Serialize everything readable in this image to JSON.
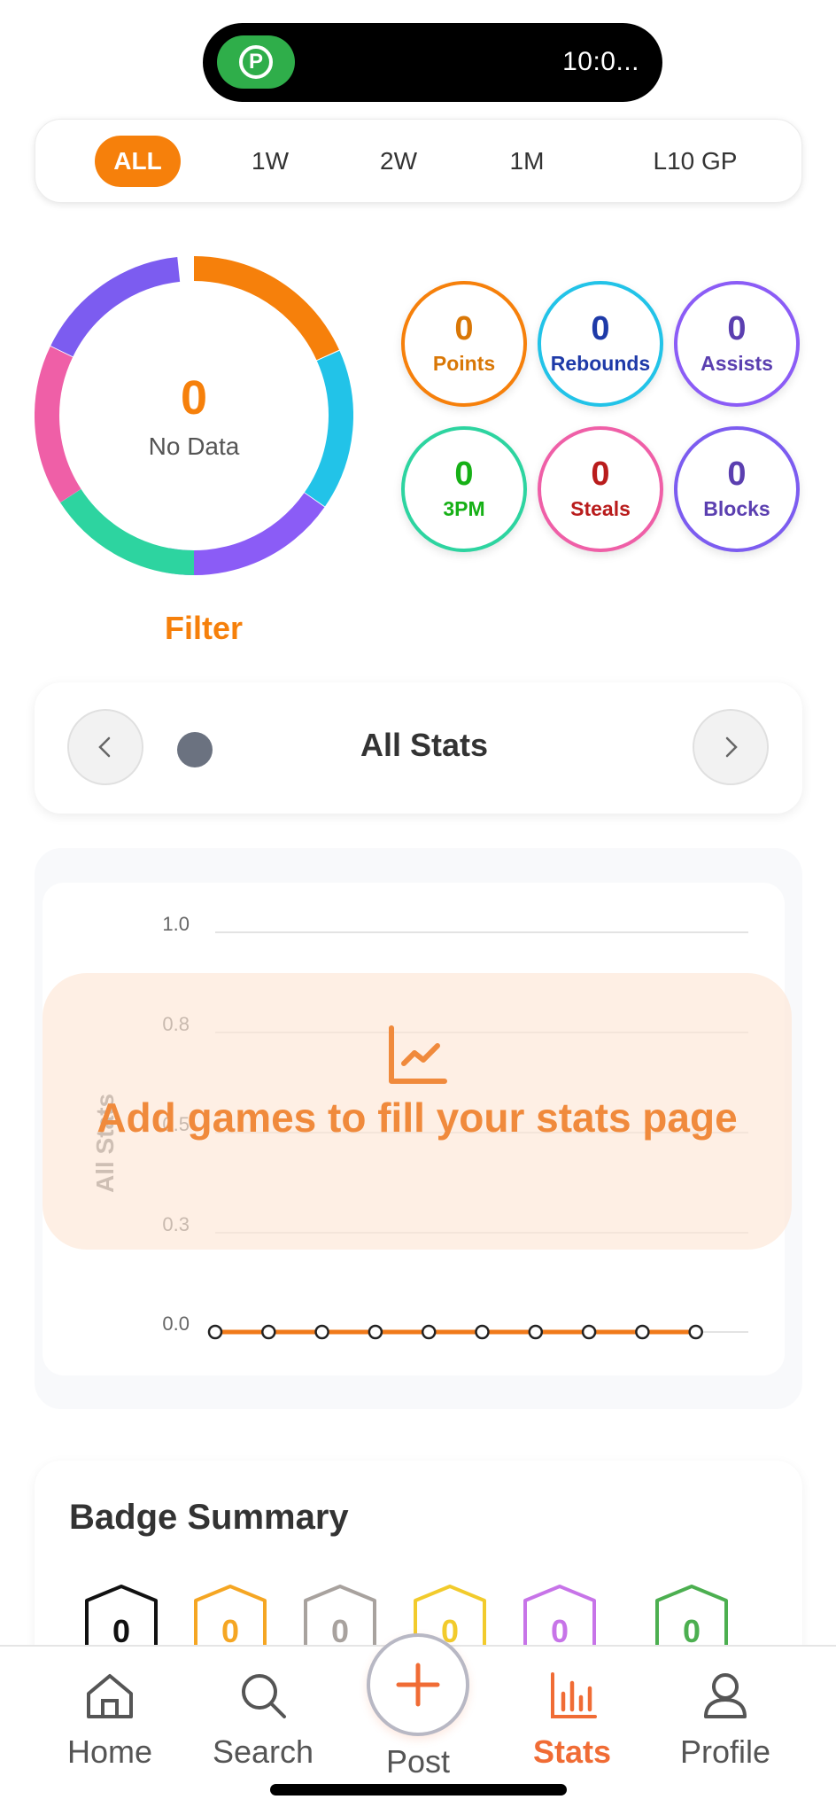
{
  "status": {
    "time": "10:0..."
  },
  "range_filter": {
    "options": [
      "ALL",
      "1W",
      "2W",
      "1M",
      "L10 GP"
    ],
    "selected": "ALL"
  },
  "summary": {
    "total": "0",
    "total_label": "No Data",
    "filter_label": "Filter",
    "stats": [
      {
        "value": "0",
        "label": "Points",
        "color": "#f6800b",
        "text_color": "#d97706"
      },
      {
        "value": "0",
        "label": "Rebounds",
        "color": "#22c3e8",
        "text_color": "#1e3aa8"
      },
      {
        "value": "0",
        "label": "Assists",
        "color": "#8b5cf6",
        "text_color": "#5b3fb0"
      },
      {
        "value": "0",
        "label": "3PM",
        "color": "#2dd4a0",
        "text_color": "#16b016"
      },
      {
        "value": "0",
        "label": "Steals",
        "color": "#ef5fa7",
        "text_color": "#b91c1c"
      },
      {
        "value": "0",
        "label": "Blocks",
        "color": "#7c5cf0",
        "text_color": "#5b3fb0"
      }
    ]
  },
  "stat_selector": {
    "title": "All Stats"
  },
  "chart_data": {
    "type": "line",
    "ylabel": "All Stats",
    "y_ticks": [
      "1.0",
      "0.8",
      "0.5",
      "0.3",
      "0.0"
    ],
    "ylim": [
      0,
      1
    ],
    "grid": true,
    "series": [
      {
        "values": [
          0,
          0,
          0,
          0,
          0,
          0,
          0,
          0,
          0,
          0
        ]
      }
    ],
    "line_color": "#f07a1a"
  },
  "empty_state": {
    "icon": "line-chart-icon",
    "message": "Add games to fill your stats page"
  },
  "badges": {
    "title": "Badge Summary",
    "items": [
      {
        "count": "0",
        "color": "#111111"
      },
      {
        "count": "0",
        "color": "#f5a623"
      },
      {
        "count": "0",
        "color": "#a8a29e"
      },
      {
        "count": "0",
        "color": "#f2cb2c"
      },
      {
        "count": "0",
        "color": "#c774e8"
      },
      {
        "count": "0",
        "color": "#4caf50"
      }
    ]
  },
  "tabbar": {
    "home": "Home",
    "search": "Search",
    "post": "Post",
    "stats": "Stats",
    "profile": "Profile",
    "active": "Stats"
  }
}
